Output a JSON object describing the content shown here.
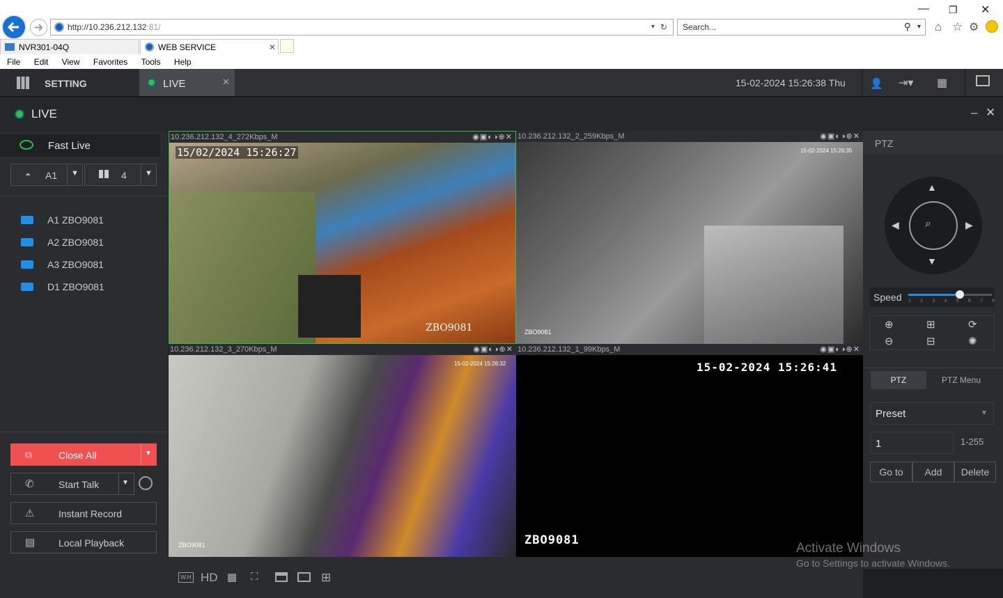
{
  "browser": {
    "url_host": "http://10.236.212.132",
    "url_port": ":81/",
    "search_placeholder": "Search...",
    "tabs": [
      {
        "label": "NVR301-04Q"
      },
      {
        "label": "WEB SERVICE"
      }
    ],
    "menu": [
      "File",
      "Edit",
      "View",
      "Favorites",
      "Tools",
      "Help"
    ]
  },
  "topbar": {
    "setting_label": "SETTING",
    "live_tab_label": "LIVE",
    "datetime": "15-02-2024 15:26:38 Thu"
  },
  "header": {
    "title": "LIVE"
  },
  "left": {
    "fast_live_label": "Fast Live",
    "channel_select": "A1",
    "layout_select": "4",
    "cameras": [
      {
        "label": "A1 ZBO9081"
      },
      {
        "label": "A2 ZBO9081"
      },
      {
        "label": "A3 ZBO9081"
      },
      {
        "label": "D1 ZBO9081"
      }
    ],
    "close_all_label": "Close All",
    "start_talk_label": "Start Talk",
    "instant_record_label": "Instant Record",
    "local_playback_label": "Local Playback"
  },
  "videos": [
    {
      "title": "10.236.212.132_4_272Kbps_M",
      "osd_time": "15/02/2024 15:26:27",
      "osd_name": "ZBO9081"
    },
    {
      "title": "10.236.212.132_2_259Kbps_M",
      "osd_time": "15-02-2024 15:26:35",
      "osd_name": "ZBO9081"
    },
    {
      "title": "10.236.212.132_3_270Kbps_M",
      "osd_time": "15-02-2024 15:26:32",
      "osd_name": "ZBO9081"
    },
    {
      "title": "10.236.212.132_1_99Kbps_M",
      "osd_time": "15-02-2024 15:26:41",
      "osd_name": "ZBO9081"
    }
  ],
  "bottombar": {
    "hd_label": "HD",
    "wh_label": "W:H"
  },
  "ptz": {
    "title": "PTZ",
    "speed_label": "Speed",
    "speed_ticks": [
      "1",
      "2",
      "3",
      "4",
      "5",
      "6",
      "7",
      "8"
    ],
    "speed_value": 5,
    "tab_ptz": "PTZ",
    "tab_menu": "PTZ Menu",
    "preset_select": "Preset",
    "preset_value": "1",
    "preset_range": "1-255",
    "goto_label": "Go to",
    "add_label": "Add",
    "delete_label": "Delete"
  },
  "watermark": {
    "line1": "Activate Windows",
    "line2": "Go to Settings to activate Windows."
  },
  "colors": {
    "accent_green": "#2fbf4a",
    "accent_blue": "#1f8ee6",
    "close_all_red": "#f05050"
  }
}
